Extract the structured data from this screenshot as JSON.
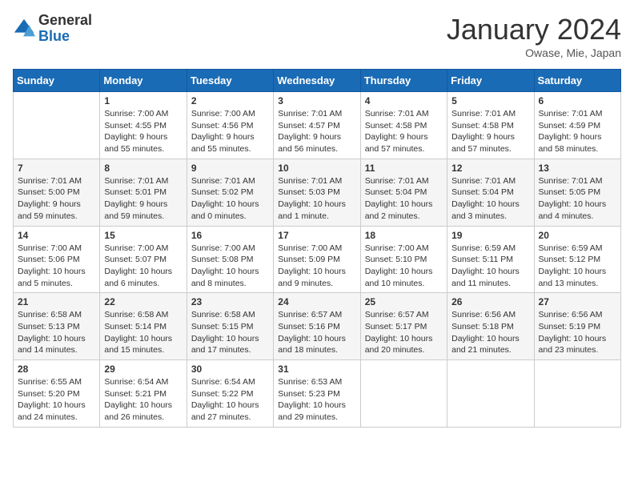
{
  "logo": {
    "general": "General",
    "blue": "Blue"
  },
  "title": "January 2024",
  "location": "Owase, Mie, Japan",
  "headers": [
    "Sunday",
    "Monday",
    "Tuesday",
    "Wednesday",
    "Thursday",
    "Friday",
    "Saturday"
  ],
  "weeks": [
    [
      {
        "day": "",
        "sunrise": "",
        "sunset": "",
        "daylight": ""
      },
      {
        "day": "1",
        "sunrise": "Sunrise: 7:00 AM",
        "sunset": "Sunset: 4:55 PM",
        "daylight": "Daylight: 9 hours and 55 minutes."
      },
      {
        "day": "2",
        "sunrise": "Sunrise: 7:00 AM",
        "sunset": "Sunset: 4:56 PM",
        "daylight": "Daylight: 9 hours and 55 minutes."
      },
      {
        "day": "3",
        "sunrise": "Sunrise: 7:01 AM",
        "sunset": "Sunset: 4:57 PM",
        "daylight": "Daylight: 9 hours and 56 minutes."
      },
      {
        "day": "4",
        "sunrise": "Sunrise: 7:01 AM",
        "sunset": "Sunset: 4:58 PM",
        "daylight": "Daylight: 9 hours and 57 minutes."
      },
      {
        "day": "5",
        "sunrise": "Sunrise: 7:01 AM",
        "sunset": "Sunset: 4:58 PM",
        "daylight": "Daylight: 9 hours and 57 minutes."
      },
      {
        "day": "6",
        "sunrise": "Sunrise: 7:01 AM",
        "sunset": "Sunset: 4:59 PM",
        "daylight": "Daylight: 9 hours and 58 minutes."
      }
    ],
    [
      {
        "day": "7",
        "sunrise": "Sunrise: 7:01 AM",
        "sunset": "Sunset: 5:00 PM",
        "daylight": "Daylight: 9 hours and 59 minutes."
      },
      {
        "day": "8",
        "sunrise": "Sunrise: 7:01 AM",
        "sunset": "Sunset: 5:01 PM",
        "daylight": "Daylight: 9 hours and 59 minutes."
      },
      {
        "day": "9",
        "sunrise": "Sunrise: 7:01 AM",
        "sunset": "Sunset: 5:02 PM",
        "daylight": "Daylight: 10 hours and 0 minutes."
      },
      {
        "day": "10",
        "sunrise": "Sunrise: 7:01 AM",
        "sunset": "Sunset: 5:03 PM",
        "daylight": "Daylight: 10 hours and 1 minute."
      },
      {
        "day": "11",
        "sunrise": "Sunrise: 7:01 AM",
        "sunset": "Sunset: 5:04 PM",
        "daylight": "Daylight: 10 hours and 2 minutes."
      },
      {
        "day": "12",
        "sunrise": "Sunrise: 7:01 AM",
        "sunset": "Sunset: 5:04 PM",
        "daylight": "Daylight: 10 hours and 3 minutes."
      },
      {
        "day": "13",
        "sunrise": "Sunrise: 7:01 AM",
        "sunset": "Sunset: 5:05 PM",
        "daylight": "Daylight: 10 hours and 4 minutes."
      }
    ],
    [
      {
        "day": "14",
        "sunrise": "Sunrise: 7:00 AM",
        "sunset": "Sunset: 5:06 PM",
        "daylight": "Daylight: 10 hours and 5 minutes."
      },
      {
        "day": "15",
        "sunrise": "Sunrise: 7:00 AM",
        "sunset": "Sunset: 5:07 PM",
        "daylight": "Daylight: 10 hours and 6 minutes."
      },
      {
        "day": "16",
        "sunrise": "Sunrise: 7:00 AM",
        "sunset": "Sunset: 5:08 PM",
        "daylight": "Daylight: 10 hours and 8 minutes."
      },
      {
        "day": "17",
        "sunrise": "Sunrise: 7:00 AM",
        "sunset": "Sunset: 5:09 PM",
        "daylight": "Daylight: 10 hours and 9 minutes."
      },
      {
        "day": "18",
        "sunrise": "Sunrise: 7:00 AM",
        "sunset": "Sunset: 5:10 PM",
        "daylight": "Daylight: 10 hours and 10 minutes."
      },
      {
        "day": "19",
        "sunrise": "Sunrise: 6:59 AM",
        "sunset": "Sunset: 5:11 PM",
        "daylight": "Daylight: 10 hours and 11 minutes."
      },
      {
        "day": "20",
        "sunrise": "Sunrise: 6:59 AM",
        "sunset": "Sunset: 5:12 PM",
        "daylight": "Daylight: 10 hours and 13 minutes."
      }
    ],
    [
      {
        "day": "21",
        "sunrise": "Sunrise: 6:58 AM",
        "sunset": "Sunset: 5:13 PM",
        "daylight": "Daylight: 10 hours and 14 minutes."
      },
      {
        "day": "22",
        "sunrise": "Sunrise: 6:58 AM",
        "sunset": "Sunset: 5:14 PM",
        "daylight": "Daylight: 10 hours and 15 minutes."
      },
      {
        "day": "23",
        "sunrise": "Sunrise: 6:58 AM",
        "sunset": "Sunset: 5:15 PM",
        "daylight": "Daylight: 10 hours and 17 minutes."
      },
      {
        "day": "24",
        "sunrise": "Sunrise: 6:57 AM",
        "sunset": "Sunset: 5:16 PM",
        "daylight": "Daylight: 10 hours and 18 minutes."
      },
      {
        "day": "25",
        "sunrise": "Sunrise: 6:57 AM",
        "sunset": "Sunset: 5:17 PM",
        "daylight": "Daylight: 10 hours and 20 minutes."
      },
      {
        "day": "26",
        "sunrise": "Sunrise: 6:56 AM",
        "sunset": "Sunset: 5:18 PM",
        "daylight": "Daylight: 10 hours and 21 minutes."
      },
      {
        "day": "27",
        "sunrise": "Sunrise: 6:56 AM",
        "sunset": "Sunset: 5:19 PM",
        "daylight": "Daylight: 10 hours and 23 minutes."
      }
    ],
    [
      {
        "day": "28",
        "sunrise": "Sunrise: 6:55 AM",
        "sunset": "Sunset: 5:20 PM",
        "daylight": "Daylight: 10 hours and 24 minutes."
      },
      {
        "day": "29",
        "sunrise": "Sunrise: 6:54 AM",
        "sunset": "Sunset: 5:21 PM",
        "daylight": "Daylight: 10 hours and 26 minutes."
      },
      {
        "day": "30",
        "sunrise": "Sunrise: 6:54 AM",
        "sunset": "Sunset: 5:22 PM",
        "daylight": "Daylight: 10 hours and 27 minutes."
      },
      {
        "day": "31",
        "sunrise": "Sunrise: 6:53 AM",
        "sunset": "Sunset: 5:23 PM",
        "daylight": "Daylight: 10 hours and 29 minutes."
      },
      {
        "day": "",
        "sunrise": "",
        "sunset": "",
        "daylight": ""
      },
      {
        "day": "",
        "sunrise": "",
        "sunset": "",
        "daylight": ""
      },
      {
        "day": "",
        "sunrise": "",
        "sunset": "",
        "daylight": ""
      }
    ]
  ]
}
